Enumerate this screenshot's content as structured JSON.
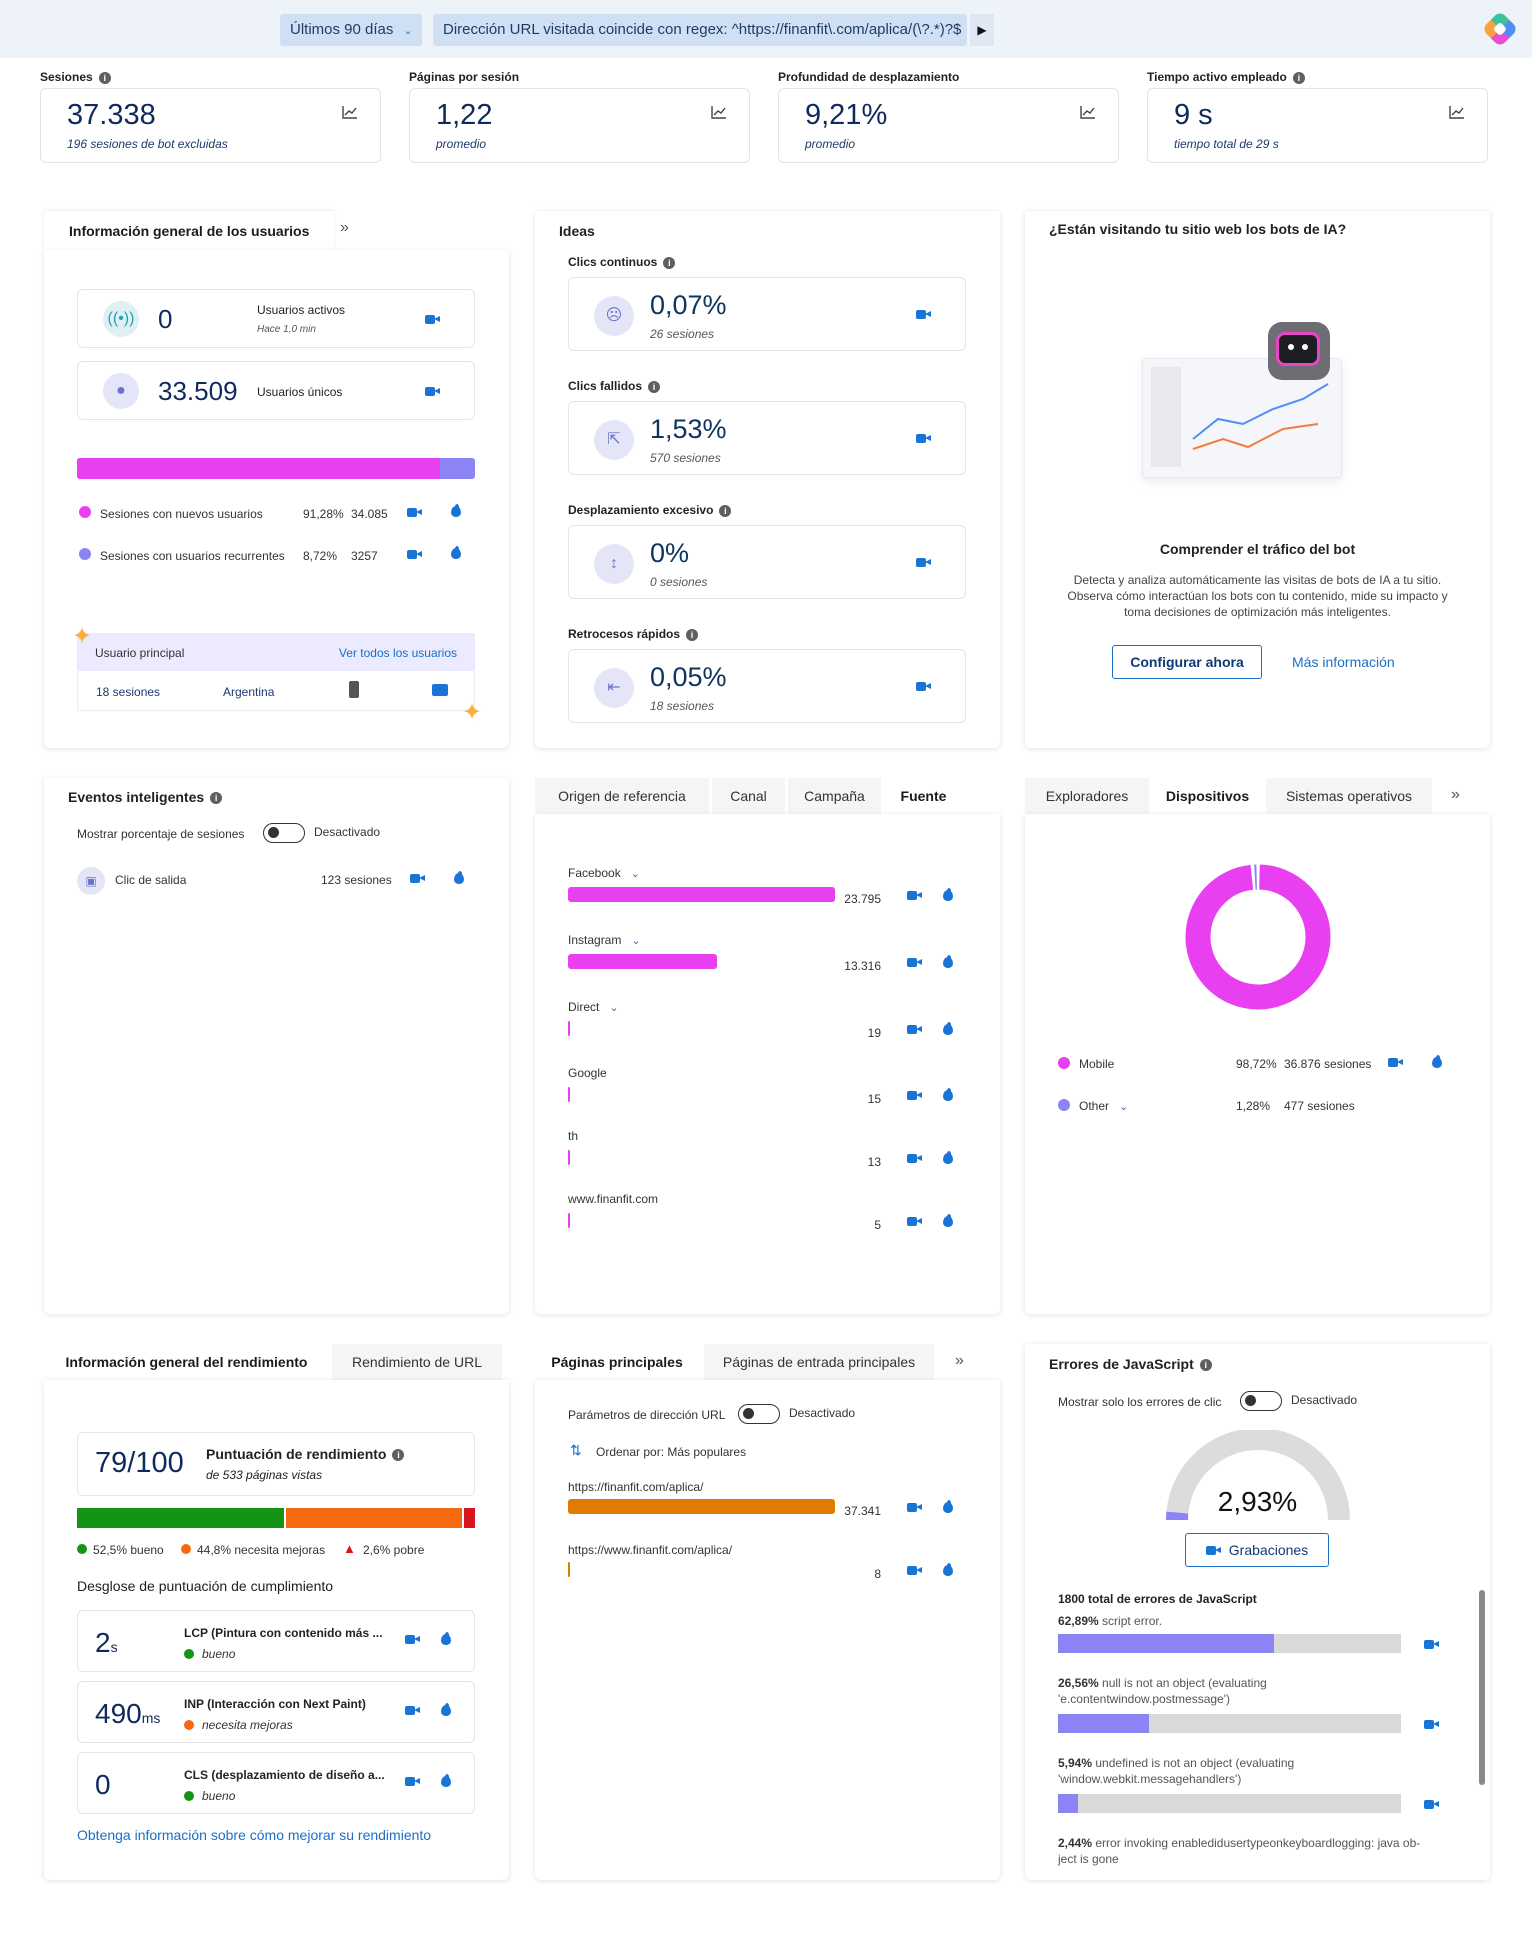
{
  "filters": {
    "date_range": "Últimos 90 días",
    "url_filter": "Dirección URL visitada coincide con regex: ^https://finanfit\\.com/aplica/(\\?.*)?$"
  },
  "metrics": [
    {
      "label": "Sesiones",
      "value": "37.338",
      "sub": "196 sesiones de bot excluidas",
      "info": true
    },
    {
      "label": "Páginas por sesión",
      "value": "1,22",
      "sub": "promedio",
      "info": false
    },
    {
      "label": "Profundidad de desplazamiento",
      "value": "9,21%",
      "sub": "promedio",
      "info": false
    },
    {
      "label": "Tiempo activo empleado",
      "value": "9 s",
      "sub": "tiempo total de 29 s",
      "info": true
    }
  ],
  "users": {
    "title": "Información general de los usuarios",
    "active_value": "0",
    "active_label": "Usuarios activos",
    "active_sub": "Hace 1,0 min",
    "unique_value": "33.509",
    "unique_label": "Usuarios únicos",
    "new_share": 0.9128,
    "rows": [
      {
        "label": "Sesiones con nuevos usuarios",
        "pct": "91,28%",
        "count": "34.085",
        "color": "#e83ff0"
      },
      {
        "label": "Sesiones con usuarios recurrentes",
        "pct": "8,72%",
        "count": "3257",
        "color": "#8c84f5"
      }
    ],
    "top_user_label": "Usuario principal",
    "see_all": "Ver todos los usuarios",
    "top_sessions": "18 sesiones",
    "top_country": "Argentina"
  },
  "ideas": {
    "title": "Ideas",
    "items": [
      {
        "label": "Clics continuos",
        "value": "0,07%",
        "sub": "26 sesiones",
        "icon": "angry-face-icon"
      },
      {
        "label": "Clics fallidos",
        "value": "1,53%",
        "sub": "570 sesiones",
        "icon": "dead-click-icon"
      },
      {
        "label": "Desplazamiento excesivo",
        "value": "0%",
        "sub": "0 sesiones",
        "icon": "scroll-icon"
      },
      {
        "label": "Retrocesos rápidos",
        "value": "0,05%",
        "sub": "18 sesiones",
        "icon": "back-icon"
      }
    ]
  },
  "bots": {
    "title": "¿Están visitando tu sitio web los bots de IA?",
    "heading": "Comprender el tráfico del bot",
    "desc_1": "Detecta y analiza automáticamente las visitas de bots de IA a tu sitio.",
    "desc_2": "Observa cómo interactúan los bots con tu contenido, mide su impacto y",
    "desc_3": "toma decisiones de optimización más inteligentes.",
    "cta": "Configurar ahora",
    "more": "Más información"
  },
  "smart_events": {
    "title": "Eventos inteligentes",
    "toggle_label": "Mostrar porcentaje de sesiones",
    "toggle_state": "Desactivado",
    "event_label": "Clic de salida",
    "event_count": "123 sesiones"
  },
  "referrers": {
    "tabs": [
      "Origen de referencia",
      "Canal",
      "Campaña",
      "Fuente"
    ],
    "active_tab": 3,
    "max": 23795,
    "rows": [
      {
        "name": "Facebook",
        "value": 23795,
        "display": "23.795",
        "expand": true
      },
      {
        "name": "Instagram",
        "value": 13316,
        "display": "13.316",
        "expand": true
      },
      {
        "name": "Direct",
        "value": 19,
        "display": "19",
        "expand": true
      },
      {
        "name": "Google",
        "value": 15,
        "display": "15",
        "expand": false
      },
      {
        "name": "th",
        "value": 13,
        "display": "13",
        "expand": false
      },
      {
        "name": "www.finanfit.com",
        "value": 5,
        "display": "5",
        "expand": false
      }
    ]
  },
  "devices": {
    "tabs": [
      "Exploradores",
      "Dispositivos",
      "Sistemas operativos"
    ],
    "active_tab": 1,
    "rows": [
      {
        "name": "Mobile",
        "pct": "98,72%",
        "sessions": "36.876 sesiones",
        "share": 0.9872,
        "color": "#e83ff0",
        "expand": false
      },
      {
        "name": "Other",
        "pct": "1,28%",
        "sessions": "477 sesiones",
        "share": 0.0128,
        "color": "#8c84f5",
        "expand": true
      }
    ]
  },
  "performance": {
    "tabs": [
      "Información general del rendimiento",
      "Rendimiento de URL"
    ],
    "score": "79/100",
    "score_label": "Puntuación de rendimiento",
    "score_sub": "de 533 páginas vistas",
    "dist": [
      {
        "label": "52,5% bueno",
        "share": 0.525,
        "color": "#149414"
      },
      {
        "label": "44,8% necesita mejoras",
        "share": 0.448,
        "color": "#f56a0f"
      },
      {
        "label": "2,6% pobre",
        "share": 0.026,
        "color": "#d7151f"
      }
    ],
    "breakdown_title": "Desglose de puntuación de cumplimiento",
    "vitals": [
      {
        "value": "2",
        "unit": "s",
        "name": "LCP (Pintura con contenido más ...",
        "status": "bueno",
        "color": "#149414"
      },
      {
        "value": "490",
        "unit": "ms",
        "name": "INP (Interacción con Next Paint)",
        "status": "necesita mejoras",
        "color": "#f56a0f"
      },
      {
        "value": "0",
        "unit": "",
        "name": "CLS (desplazamiento de diseño a...",
        "status": "bueno",
        "color": "#149414"
      }
    ],
    "learn_more": "Obtenga información sobre cómo mejorar su rendimiento"
  },
  "pages": {
    "tabs": [
      "Páginas principales",
      "Páginas de entrada principales"
    ],
    "toggle_label": "Parámetros de dirección URL",
    "toggle_state": "Desactivado",
    "sort_label": "Ordenar por: Más populares",
    "max": 37341,
    "rows": [
      {
        "url": "https://finanfit.com/aplica/",
        "value": 37341,
        "display": "37.341"
      },
      {
        "url": "https://www.finanfit.com/aplica/",
        "value": 8,
        "display": "8"
      }
    ]
  },
  "js_errors": {
    "title": "Errores de JavaScript",
    "toggle_label": "Mostrar solo los errores de clic",
    "toggle_state": "Desactivado",
    "rate": "2,93%",
    "rate_value": 0.0293,
    "recordings": "Grabaciones",
    "total": "1800 total de errores de JavaScript",
    "rows": [
      {
        "pct": "62,89%",
        "msg": "script error.",
        "msg2": "",
        "share": 0.6289
      },
      {
        "pct": "26,56%",
        "msg": "null is not an object (evaluating",
        "msg2": "'e.contentwindow.postmessage')",
        "share": 0.2656
      },
      {
        "pct": "5,94%",
        "msg": "undefined is not an object (evaluating",
        "msg2": "'window.webkit.messagehandlers')",
        "share": 0.0594
      },
      {
        "pct": "2,44%",
        "msg": "error invoking enabledidusertypeonkeyboardlogging: java ob-",
        "msg2": "ject is gone",
        "share": 0.0244
      }
    ]
  }
}
